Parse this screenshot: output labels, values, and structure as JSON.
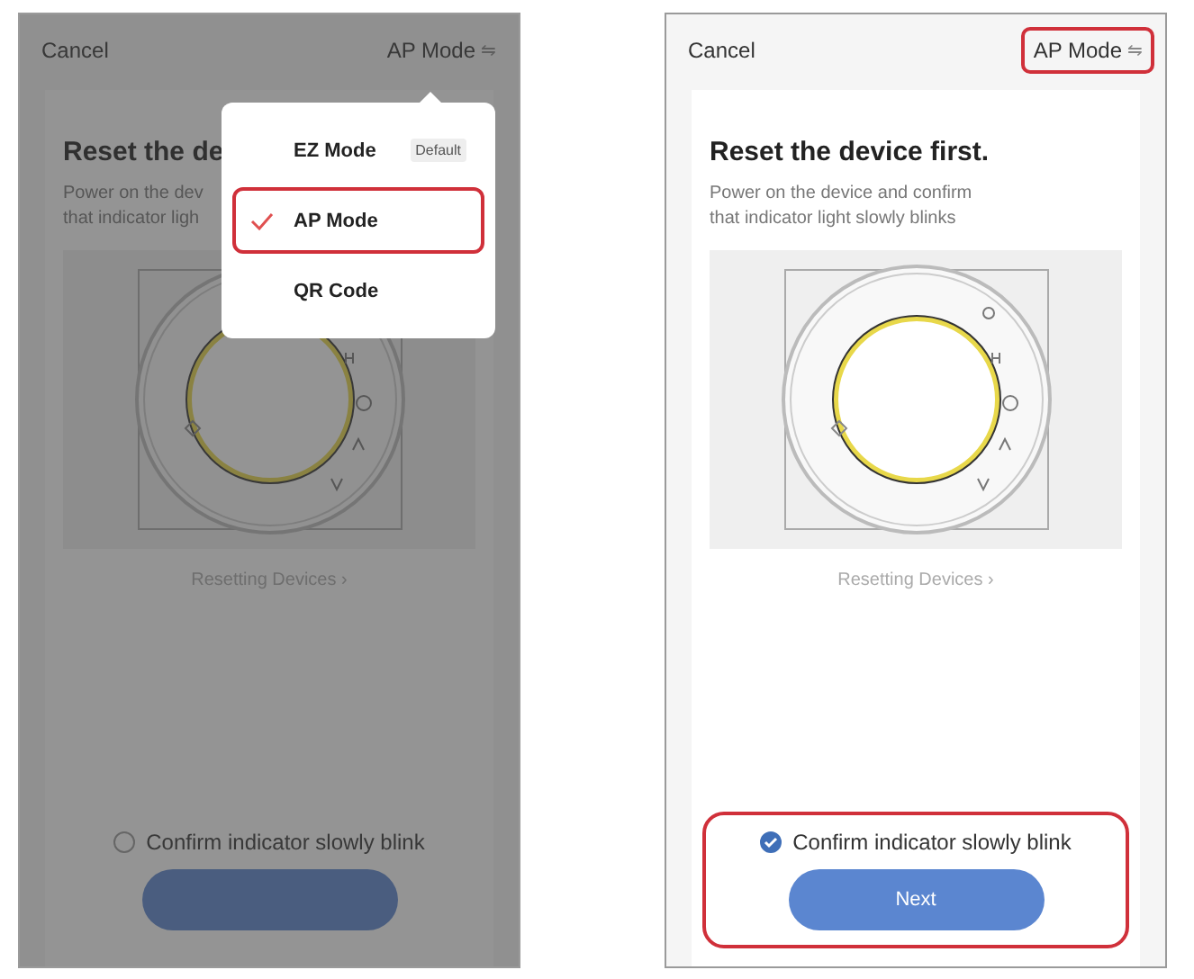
{
  "screens": [
    {
      "dimmed": true,
      "cancel": "Cancel",
      "mode": {
        "label": "AP Mode",
        "icon": "⇋",
        "highlighted": false
      },
      "title": "Reset the de",
      "description": [
        "Power on the dev",
        "that indicator ligh"
      ],
      "caption": "Resetting Devices",
      "caption_arrow": "›",
      "confirm": {
        "label": "Confirm indicator slowly blink",
        "checked": false
      },
      "menu": {
        "items": [
          {
            "label": "EZ Mode",
            "badge": "Default",
            "selected": false,
            "highlighted": false
          },
          {
            "label": "AP Mode",
            "selected": true,
            "highlighted": true
          },
          {
            "label": "QR Code",
            "selected": false,
            "highlighted": false
          }
        ]
      }
    },
    {
      "dimmed": false,
      "cancel": "Cancel",
      "mode": {
        "label": "AP Mode",
        "icon": "⇋",
        "highlighted": true
      },
      "title": "Reset the device first.",
      "description": [
        "Power on the device and confirm",
        "that indicator light slowly blinks"
      ],
      "caption": "Resetting Devices",
      "caption_arrow": "›",
      "confirm": {
        "label": "Confirm indicator slowly blink",
        "checked": true
      },
      "next": "Next",
      "footer_highlighted": true
    }
  ]
}
